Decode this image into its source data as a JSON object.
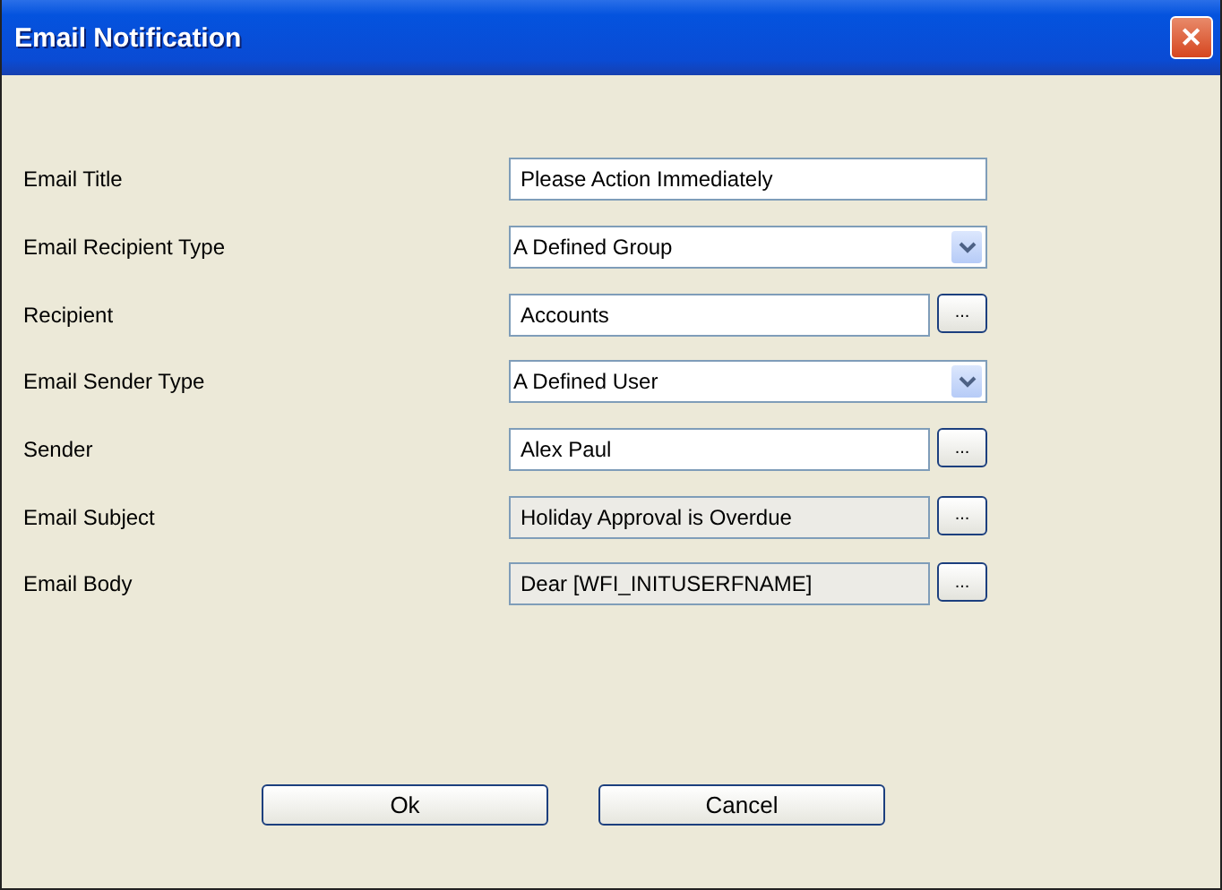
{
  "window": {
    "title": "Email Notification",
    "close": "✕"
  },
  "fields": [
    {
      "label": "Email Title",
      "kind": "text",
      "value": "Please Action Immediately",
      "disabled": false
    },
    {
      "label": "Email Recipient Type",
      "kind": "dropdown",
      "value": "A Defined Group",
      "disabled": false
    },
    {
      "label": "Recipient",
      "kind": "lookup",
      "value": "Accounts",
      "disabled": false,
      "button": "..."
    },
    {
      "label": "Email Sender Type",
      "kind": "dropdown",
      "value": "A Defined User",
      "disabled": false
    },
    {
      "label": "Sender",
      "kind": "lookup",
      "value": "Alex Paul",
      "disabled": false,
      "button": "..."
    },
    {
      "label": "Email Subject",
      "kind": "lookup",
      "value": "Holiday Approval is Overdue",
      "disabled": true,
      "button": "..."
    },
    {
      "label": "Email Body",
      "kind": "lookup",
      "value": "Dear [WFI_INITUSERFNAME]",
      "disabled": true,
      "button": "..."
    }
  ],
  "buttons": [
    "Ok",
    "Cancel"
  ]
}
